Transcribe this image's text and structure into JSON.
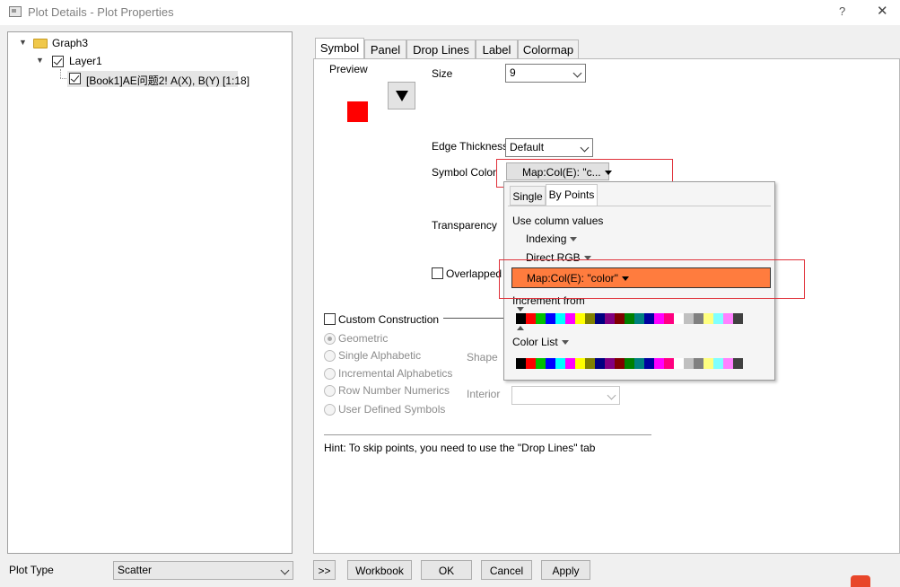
{
  "window": {
    "title": "Plot Details - Plot Properties",
    "help": "?",
    "close": "✕"
  },
  "tree": {
    "graph": "Graph3",
    "layer": "Layer1",
    "plot": "[Book1]AE问题2! A(X), B(Y) [1:18]"
  },
  "tabs": [
    "Symbol",
    "Panel",
    "Drop Lines",
    "Label",
    "Colormap"
  ],
  "symbol": {
    "preview_label": "Preview",
    "preview_color": "#ff0000",
    "size_label": "Size",
    "size_value": "9",
    "edge_thickness_label": "Edge Thickness",
    "edge_thickness_value": "Default",
    "symbol_color_label": "Symbol Color",
    "symbol_color_value": "Map:Col(E): \"c...",
    "transparency_label": "Transparency",
    "overlapped_label": "Overlapped P",
    "custom_construction_label": "Custom Construction",
    "construction_options": [
      "Geometric",
      "Single Alphabetic",
      "Incremental Alphabetics",
      "Row Number Numerics",
      "User Defined Symbols"
    ],
    "shape_label": "Shape",
    "interior_label": "Interior",
    "hint": "Hint: To skip points, you need to use the \"Drop Lines\" tab"
  },
  "color_popup": {
    "tabs": [
      "Single",
      "By Points"
    ],
    "use_column_values": "Use column values",
    "indexing": "Indexing",
    "direct_rgb": "Direct RGB",
    "map_value": "Map:Col(E): \"color\"",
    "map_highlight_color": "#ff7c3e",
    "increment_from": "Increment from",
    "color_list": "Color List",
    "swatches": [
      "#000000",
      "#ff0000",
      "#00c000",
      "#0000ff",
      "#00ffff",
      "#ff00ff",
      "#ffff00",
      "#808000",
      "#000080",
      "#800080",
      "#800000",
      "#008000",
      "#008080",
      "#0000a0",
      "#ff00ff",
      "#ff0080",
      "#ffffff",
      "#c0c0c0",
      "#808080",
      "#ffff80",
      "#80ffff",
      "#ff80ff",
      "#404040"
    ]
  },
  "bottom": {
    "plot_type_label": "Plot Type",
    "plot_type_value": "Scatter",
    "expand": ">>",
    "workbook": "Workbook",
    "ok": "OK",
    "cancel": "Cancel",
    "apply": "Apply"
  },
  "colors": {
    "highlight_box": "#e0313a",
    "ime_logo": "#e8462a"
  }
}
